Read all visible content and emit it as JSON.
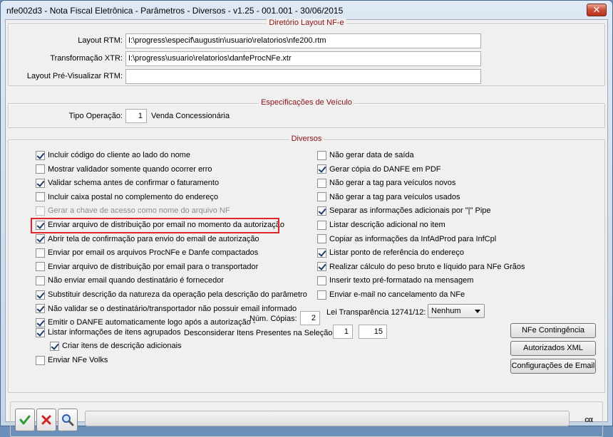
{
  "window": {
    "title": "nfe002d3 - Nota Fiscal Eletrônica - Parâmetros - Diversos - v1.25 - 001.001 - 30/06/2015",
    "close_label": "✕"
  },
  "layout_group": {
    "title": "Diretório Layout NF-e",
    "fields": [
      {
        "label": "Layout RTM:",
        "value": "I:\\progress\\especif\\augustin\\usuario\\relatorios\\nfe200.rtm"
      },
      {
        "label": "Transformação XTR:",
        "value": "I:\\progress\\usuario\\relatorios\\danfeProcNFe.xtr"
      },
      {
        "label": "Layout Pré-Visualizar RTM:",
        "value": ""
      }
    ]
  },
  "vehicle_group": {
    "title": "Especificações de Veículo",
    "operation_label": "Tipo Operação:",
    "operation_code": "1",
    "operation_desc": "Venda Concessionária"
  },
  "diversos": {
    "title": "Diversos",
    "left_options": [
      {
        "label": "Incluir código do cliente ao lado do nome",
        "checked": true
      },
      {
        "label": "Mostrar validador somente quando ocorrer erro",
        "checked": false
      },
      {
        "label": "Validar schema antes de confirmar o faturamento",
        "checked": true
      },
      {
        "label": "Incluir caixa postal no complemento do endereço",
        "checked": false
      },
      {
        "label": "Gerar a chave de acesso como nome do arquivo NF",
        "checked": false,
        "disabled": true
      },
      {
        "label": "Enviar arquivo de distribuição por email no momento da autorização",
        "checked": true
      },
      {
        "label": "Abrir tela de confirmação para envio do email de autorização",
        "checked": true
      },
      {
        "label": "Enviar por email os arquivos ProcNFe e Danfe compactados",
        "checked": false
      },
      {
        "label": "Enviar arquivo de distribuição por email para o transportador",
        "checked": false
      },
      {
        "label": "Não enviar email quando destinatário é fornecedor",
        "checked": false
      },
      {
        "label": "Substituir descrição da natureza da operação pela descrição do parâmetro",
        "checked": true
      },
      {
        "label": "Não validar se o destinatário/transportador não possuir email informado",
        "checked": true
      },
      {
        "label": "Emitir o DANFE automaticamente logo após a autorização -",
        "checked": true
      },
      {
        "label": "Listar informações de itens agrupados",
        "checked": true
      },
      {
        "label": "Criar itens de descrição adicionais",
        "checked": true
      },
      {
        "label": "Enviar NFe Volks",
        "checked": false
      }
    ],
    "right_options": [
      {
        "label": "Não gerar data de saída",
        "checked": false
      },
      {
        "label": "Gerar cópia do DANFE em PDF",
        "checked": true
      },
      {
        "label": "Não gerar a tag para veículos novos",
        "checked": false
      },
      {
        "label": "Não gerar a tag para veículos usados",
        "checked": false
      },
      {
        "label": "Separar as informações adicionais por \"|\" Pipe",
        "checked": true
      },
      {
        "label": "Listar descrição adicional no item",
        "checked": false
      },
      {
        "label": "Copiar as informações da InfAdProd para InfCpl",
        "checked": false
      },
      {
        "label": "Listar ponto de referência do endereço",
        "checked": true
      },
      {
        "label": "Realizar cálculo do peso bruto e líquido para NFe Grãos",
        "checked": true
      },
      {
        "label": "Inserir texto pré-formatado na mensagem",
        "checked": false
      },
      {
        "label": "Enviar e-mail no cancelamento da NFe",
        "checked": false
      }
    ],
    "copies_label": "Núm. Cópias:",
    "copies_value": "2",
    "ignore_label": "Desconsiderar Itens Presentes na Seleção:",
    "ignore_from": "1",
    "ignore_to": "15",
    "transparency_label": "Lei Transparência 12741/12:",
    "transparency_value": "Nenhum",
    "buttons": [
      "NFe Contingência",
      "Autorizados XML",
      "Configurações de Email"
    ]
  },
  "footer": {
    "ok_icon": "check-icon",
    "cancel_icon": "x-icon",
    "search_icon": "magnifier-icon",
    "logo": "cα"
  },
  "colors": {
    "group_title": "#8b1010",
    "highlight": "#e0262a",
    "ok": "#2e9a2e",
    "cancel": "#d42020"
  }
}
